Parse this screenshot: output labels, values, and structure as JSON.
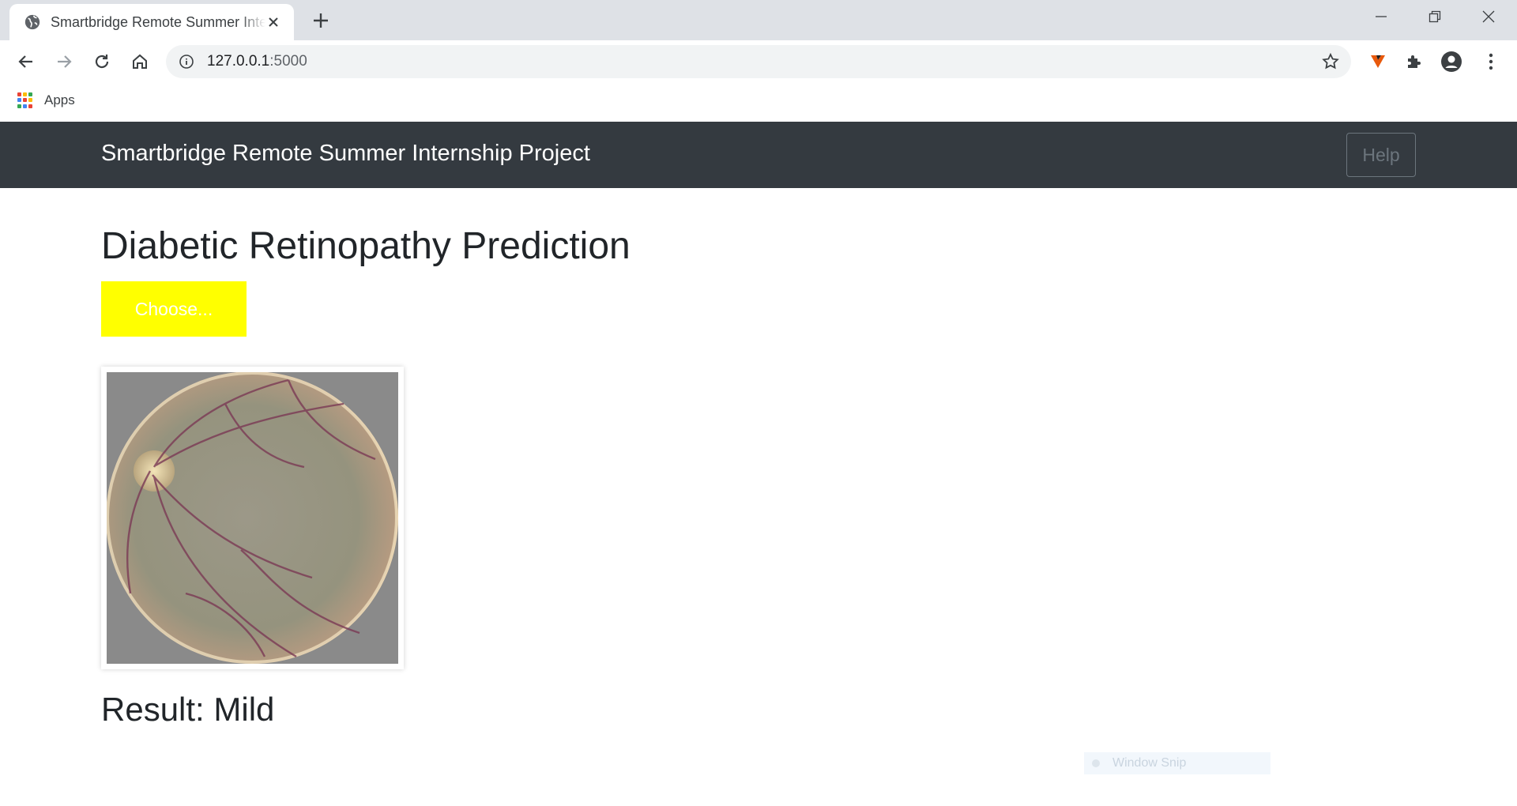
{
  "browser": {
    "tab_title": "Smartbridge Remote Summer Internship Project",
    "url_host": "127.0.0.1",
    "url_port": ":5000",
    "bookmarks": {
      "apps_label": "Apps"
    }
  },
  "navbar": {
    "brand": "Smartbridge Remote Summer Internship Project",
    "help_label": "Help"
  },
  "main": {
    "title": "Diabetic Retinopathy Prediction",
    "choose_label": "Choose...",
    "result_text": "Result: Mild"
  },
  "overlay": {
    "snip_label": "Window Snip"
  },
  "colors": {
    "navbar_bg": "#343a40",
    "choose_bg": "#ffff00",
    "help_border": "#6c757d"
  },
  "icons": [
    "globe-icon",
    "close-icon",
    "plus-icon",
    "minimize-icon",
    "restore-icon",
    "back-icon",
    "forward-icon",
    "reload-icon",
    "home-icon",
    "info-icon",
    "star-icon",
    "extension-v-icon",
    "puzzle-icon",
    "account-icon",
    "menu-icon",
    "apps-grid-icon"
  ]
}
